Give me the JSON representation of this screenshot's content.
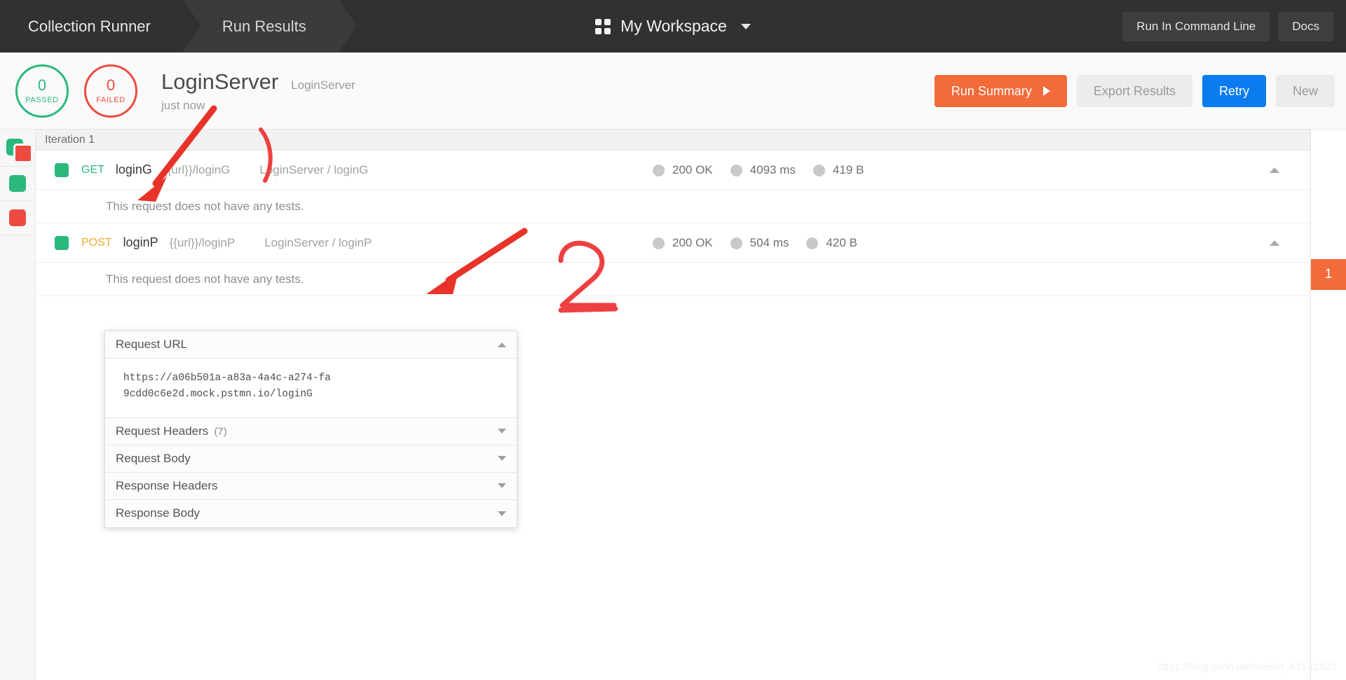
{
  "topbar": {
    "crumbs": [
      {
        "label": "Collection Runner",
        "state": "inactive"
      },
      {
        "label": "Run Results",
        "state": "active"
      }
    ],
    "workspace": {
      "label": "My Workspace",
      "icon": "grid-icon",
      "caret": "chevron-down-icon"
    },
    "buttons": [
      {
        "label": "Run In Command Line"
      },
      {
        "label": "Docs"
      }
    ]
  },
  "summary": {
    "passed": {
      "count": "0",
      "label": "PASSED",
      "color": "#2ab87d"
    },
    "failed": {
      "count": "0",
      "label": "FAILED",
      "color": "#ee4b40"
    },
    "title": "LoginServer",
    "subtitle": "LoginServer",
    "time": "just now",
    "actions": [
      {
        "label": "Run Summary",
        "style": "primary",
        "color": "#f26b39",
        "icon": "play-icon"
      },
      {
        "label": "Export Results",
        "style": "ghost",
        "color": "#ececec"
      },
      {
        "label": "Retry",
        "style": "blue",
        "color": "#0a7cf0"
      },
      {
        "label": "New",
        "style": "ghost",
        "color": "#ececec"
      }
    ]
  },
  "filters": [
    {
      "name": "all",
      "icon": "all-results-icon"
    },
    {
      "name": "passed",
      "icon": "green-square-icon"
    },
    {
      "name": "failed",
      "icon": "red-square-icon"
    }
  ],
  "results": {
    "iteration_label": "Iteration 1",
    "edge_tab": "1",
    "rows": [
      {
        "method": "GET",
        "name": "loginG",
        "url": "{{url}}/loginG",
        "path": "LoginServer / loginG",
        "status": "200 OK",
        "time": "4093 ms",
        "size": "419 B",
        "tests_message": "This request does not have any tests."
      },
      {
        "method": "POST",
        "name": "loginP",
        "url": "{{url}}/loginP",
        "path": "LoginServer / loginP",
        "status": "200 OK",
        "time": "504 ms",
        "size": "420 B",
        "tests_message": "This request does not have any tests."
      }
    ]
  },
  "popup": {
    "sections": [
      {
        "title": "Request URL",
        "count": "",
        "expanded": true,
        "value": "https://a06b501a-a83a-4a4c-a274-fa9cdd0c6e2d.mock.pstmn.io/loginG"
      },
      {
        "title": "Request Headers",
        "count": "(7)",
        "expanded": false,
        "value": ""
      },
      {
        "title": "Request Body",
        "count": "",
        "expanded": false,
        "value": ""
      },
      {
        "title": "Response Headers",
        "count": "",
        "expanded": false,
        "value": ""
      },
      {
        "title": "Response Body",
        "count": "",
        "expanded": false,
        "value": ""
      }
    ]
  },
  "annotations": {
    "marker_color": "#e8332a",
    "number_label": "2"
  },
  "watermark": "https://blog.csdn.net/weixin_43142423"
}
